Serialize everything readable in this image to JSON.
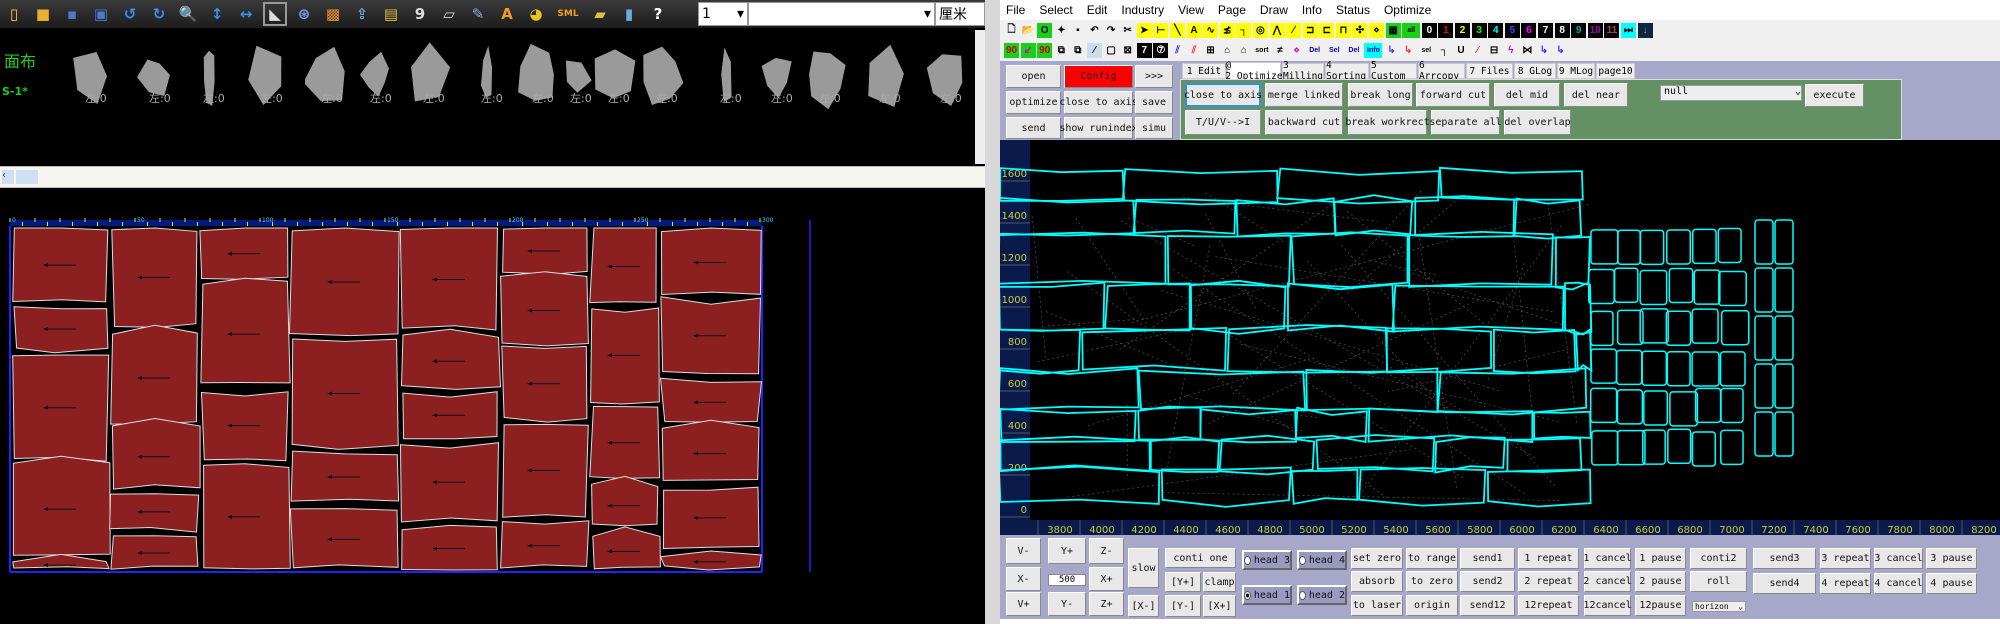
{
  "left_app": {
    "toolbar": [
      {
        "icon": "new-file-icon",
        "glyph": "▯",
        "color": "#f5c842"
      },
      {
        "icon": "open-folder-icon",
        "glyph": "■",
        "color": "#e8b030"
      },
      {
        "icon": "save-icon",
        "glyph": "▪",
        "color": "#4a7bd0"
      },
      {
        "icon": "save-as-icon",
        "glyph": "▣",
        "color": "#4a7bd0"
      },
      {
        "icon": "undo-icon",
        "glyph": "↺",
        "color": "#3a8ef0"
      },
      {
        "icon": "redo-icon",
        "glyph": "↻",
        "color": "#3a8ef0"
      },
      {
        "icon": "zoom-icon",
        "glyph": "🔍",
        "color": "#ddd"
      },
      {
        "icon": "vertical-arrows-icon",
        "glyph": "↕",
        "color": "#3a8ef0"
      },
      {
        "icon": "horizontal-arrows-icon",
        "glyph": "↔",
        "color": "#3a8ef0"
      },
      {
        "icon": "select-piece-icon",
        "glyph": "◣",
        "color": "#ddd"
      },
      {
        "icon": "film-reel-icon",
        "glyph": "⊛",
        "color": "#7aa0e0"
      },
      {
        "icon": "grid-orange-icon",
        "glyph": "▩",
        "color": "#e89030"
      },
      {
        "icon": "export-icon",
        "glyph": "⇪",
        "color": "#6aaee0"
      },
      {
        "icon": "film-icon",
        "glyph": "▤",
        "color": "#e0c040"
      },
      {
        "icon": "nine-icon",
        "glyph": "9",
        "color": "#ddd"
      },
      {
        "icon": "notepad-icon",
        "glyph": "▱",
        "color": "#ddd"
      },
      {
        "icon": "tools-icon",
        "glyph": "✎",
        "color": "#8ab0e0"
      },
      {
        "icon": "text-a-icon",
        "glyph": "A",
        "color": "#f0a020"
      },
      {
        "icon": "color-wheel-icon",
        "glyph": "◕",
        "color": "#f0c020"
      },
      {
        "icon": "sml-icon",
        "glyph": "SML",
        "color": "#f0a020"
      },
      {
        "icon": "layers-icon",
        "glyph": "▰",
        "color": "#e0c040"
      },
      {
        "icon": "bottle-icon",
        "glyph": "▮",
        "color": "#6aaee0"
      },
      {
        "icon": "help-icon",
        "glyph": "?",
        "color": "#fff"
      }
    ],
    "layer_select": "1",
    "combo_value": "",
    "unit_select": "厘米",
    "strip_title": "面布",
    "strip_row_label": "S-1*",
    "piece_labels": [
      "左:0",
      "左:0",
      "左:0",
      "左:0",
      "左:0",
      "左:0",
      "左:0",
      "左:0",
      "左:0",
      "左:0",
      "左:0",
      "左:0",
      "左:0",
      "左:0",
      "左:0",
      "左:0",
      "左:0"
    ],
    "ruler_labels": [
      "0",
      "50",
      "100",
      "150",
      "200",
      "250",
      "300"
    ],
    "piece_color": "#8c2020"
  },
  "right_app": {
    "menu": [
      "File",
      "Select",
      "Edit",
      "Industry",
      "View",
      "Page",
      "Draw",
      "Info",
      "Status",
      "Optimize"
    ],
    "toolbar1": [
      {
        "icon": "new-icon",
        "t": "🗋",
        "bg": ""
      },
      {
        "icon": "open-icon",
        "t": "📂",
        "bg": ""
      },
      {
        "icon": "circle-icon",
        "t": "O",
        "bg": "#19d019"
      },
      {
        "icon": "open-star-icon",
        "t": "✦",
        "bg": ""
      },
      {
        "icon": "save-icon",
        "t": "▪",
        "bg": ""
      },
      {
        "icon": "undo-icon",
        "t": "↶",
        "bg": ""
      },
      {
        "icon": "redo-icon",
        "t": "↷",
        "bg": ""
      },
      {
        "icon": "cut-icon",
        "t": "✂",
        "bg": ""
      },
      {
        "icon": "pointer-icon",
        "t": "➤",
        "bg": "#ffff00"
      },
      {
        "icon": "dimension-icon",
        "t": "⊢",
        "bg": "#ffff00"
      },
      {
        "icon": "line-icon",
        "t": "╲",
        "bg": "#ffff00"
      },
      {
        "icon": "text-icon",
        "t": "A",
        "bg": "#ffff00"
      },
      {
        "icon": "wave-icon",
        "t": "∿",
        "bg": "#ffff00"
      },
      {
        "icon": "curve-icon",
        "t": "≴",
        "bg": "#ffff00"
      },
      {
        "icon": "corner-icon",
        "t": "┐",
        "bg": "#ffff00"
      },
      {
        "icon": "circle-point-icon",
        "t": "◎",
        "bg": "#ffff00"
      },
      {
        "icon": "angle-icon",
        "t": "⋀",
        "bg": "#ffff00"
      },
      {
        "icon": "slash-icon",
        "t": "⁄",
        "bg": "#ffff00"
      },
      {
        "icon": "node1-icon",
        "t": "⊐",
        "bg": "#ffff00"
      },
      {
        "icon": "node2-icon",
        "t": "⊏",
        "bg": "#ffff00"
      },
      {
        "icon": "node3-icon",
        "t": "⊓",
        "bg": "#ffff00"
      },
      {
        "icon": "move-icon",
        "t": "✣",
        "bg": "#ffff00"
      },
      {
        "icon": "node4-icon",
        "t": "⋄",
        "bg": "#ffff00"
      },
      {
        "icon": "group-icon",
        "t": "▦",
        "bg": "#19d019"
      },
      {
        "icon": "all-icon",
        "t": "all",
        "bg": "#19d019"
      },
      {
        "icon": "num-0-icon",
        "t": "0",
        "bg": "#000",
        "c": "#fff"
      },
      {
        "icon": "num-1-icon",
        "t": "1",
        "bg": "#000",
        "c": "#f00"
      },
      {
        "icon": "num-2-icon",
        "t": "2",
        "bg": "#000",
        "c": "#ff0"
      },
      {
        "icon": "num-3-icon",
        "t": "3",
        "bg": "#000",
        "c": "#0f0"
      },
      {
        "icon": "num-4-icon",
        "t": "4",
        "bg": "#000",
        "c": "#0ff"
      },
      {
        "icon": "num-5-icon",
        "t": "5",
        "bg": "#000",
        "c": "#44f"
      },
      {
        "icon": "num-6-icon",
        "t": "6",
        "bg": "#000",
        "c": "#f0f"
      },
      {
        "icon": "num-7-icon",
        "t": "7",
        "bg": "#000",
        "c": "#fff"
      },
      {
        "icon": "num-8-icon",
        "t": "8",
        "bg": "#000",
        "c": "#fff"
      },
      {
        "icon": "num-9-icon",
        "t": "9",
        "bg": "#000",
        "c": "#0aa"
      },
      {
        "icon": "num-10-icon",
        "t": "10",
        "bg": "#000",
        "c": "#a0a"
      },
      {
        "icon": "num-11-icon",
        "t": "11",
        "bg": "#000",
        "c": "#a44"
      },
      {
        "icon": "skip-icon",
        "t": "⏭",
        "bg": "#0ff"
      },
      {
        "icon": "down-arrow-icon",
        "t": "↓",
        "bg": "#124",
        "c": "#0f0"
      }
    ],
    "toolbar2": [
      {
        "icon": "rotate-ccw90-icon",
        "t": "90",
        "bg": "#19d019",
        "c": "#c00"
      },
      {
        "icon": "corner-arrow-icon",
        "t": "↙",
        "bg": "#19d019",
        "c": "#c0c"
      },
      {
        "icon": "rotate-cw90-icon",
        "t": "90",
        "bg": "#19d019",
        "c": "#c00"
      },
      {
        "icon": "copy-icon",
        "t": "⧉",
        "bg": ""
      },
      {
        "icon": "delete-copy-icon",
        "t": "⧉",
        "bg": ""
      },
      {
        "icon": "cross-mark-icon",
        "t": "⁄",
        "bg": "#cde"
      },
      {
        "icon": "rounded-rect-icon",
        "t": "▢",
        "bg": ""
      },
      {
        "icon": "delete-group-icon",
        "t": "⊠",
        "bg": ""
      },
      {
        "icon": "seven-box-icon",
        "t": "7",
        "bg": "#000",
        "c": "#fff"
      },
      {
        "icon": "seven-circle-icon",
        "t": "⑦",
        "bg": "#000",
        "c": "#fff"
      },
      {
        "icon": "parallel-lines-icon",
        "t": "⫽",
        "bg": "",
        "c": "#33f"
      },
      {
        "icon": "parallel-lines2-icon",
        "t": "⫽",
        "bg": "",
        "c": "#f33"
      },
      {
        "icon": "split-squares-icon",
        "t": "⊞",
        "bg": ""
      },
      {
        "icon": "shape-icon",
        "t": "⌂",
        "bg": ""
      },
      {
        "icon": "shape2-icon",
        "t": "⌂",
        "bg": ""
      },
      {
        "icon": "sort-icon",
        "t": "sort",
        "bg": ""
      },
      {
        "icon": "path-icon",
        "t": "≠",
        "bg": ""
      },
      {
        "icon": "nodes-icon",
        "t": "⋄",
        "bg": "",
        "c": "#c0c"
      },
      {
        "icon": "del-same-icon",
        "t": "Del",
        "bg": "",
        "c": "#00a"
      },
      {
        "icon": "sel-same-icon",
        "t": "Sel",
        "bg": "",
        "c": "#00a"
      },
      {
        "icon": "del-icon",
        "t": "Del",
        "bg": "",
        "c": "#00a"
      },
      {
        "icon": "info-icon",
        "t": "Info",
        "bg": "#0ff",
        "c": "#00a"
      },
      {
        "icon": "path2-icon",
        "t": "↳",
        "bg": "",
        "c": "#33f"
      },
      {
        "icon": "path3-icon",
        "t": "↳",
        "bg": "",
        "c": "#f33"
      },
      {
        "icon": "sel-icon",
        "t": "sel",
        "bg": ""
      },
      {
        "icon": "hook-icon",
        "t": "┐",
        "bg": ""
      },
      {
        "icon": "u-icon",
        "t": "U",
        "bg": ""
      },
      {
        "icon": "edit-line-icon",
        "t": "⁄",
        "bg": "",
        "c": "#c33"
      },
      {
        "icon": "box-stack-icon",
        "t": "⊟",
        "bg": ""
      },
      {
        "icon": "zigzag-icon",
        "t": "ϟ",
        "bg": "",
        "c": "#c0c"
      },
      {
        "icon": "cross-wave-icon",
        "t": "⋈",
        "bg": ""
      },
      {
        "icon": "path4-icon",
        "t": "↳",
        "bg": "",
        "c": "#33f"
      },
      {
        "icon": "path5-icon",
        "t": "↳",
        "bg": "",
        "c": "#33f"
      }
    ],
    "side_buttons": {
      "open": "open",
      "config": "Config",
      "more": ">>>",
      "optimize": "optimize",
      "close_to_axis": "close to axis",
      "save": "save",
      "send": "send",
      "show_runindex": "show runindex",
      "simu": "simu"
    },
    "config_color": "#ff0000",
    "tabs": [
      "1 Edit",
      "@ 2_Optimize",
      "3 Milling",
      "4 Sorting",
      "5 Custom",
      "6 Arrcopy",
      "7 Files",
      "8 GLog",
      "9 MLog",
      "page10"
    ],
    "active_tab": 1,
    "optimize_panel": {
      "row1": [
        "close to axis",
        "merge linked",
        "break long",
        "forward cut",
        "del mid",
        "del near"
      ],
      "row2": [
        "T/U/V-->I",
        "backward cut",
        "break workrect",
        "separate all",
        "del overlap"
      ],
      "select_value": "null",
      "execute": "execute",
      "panel_color": "#639163"
    },
    "canvas": {
      "x_ticks": [
        "3800",
        "4000",
        "4200",
        "4400",
        "4600",
        "4800",
        "5000",
        "5200",
        "5400",
        "5600",
        "5800",
        "6000",
        "6200",
        "6400",
        "6600",
        "6800",
        "7000",
        "7200",
        "7400",
        "7600",
        "7800",
        "8000",
        "8200"
      ],
      "y_ticks": [
        "0",
        "200",
        "400",
        "600",
        "800",
        "1000",
        "1200",
        "1400",
        "1600"
      ],
      "outline_color": "#00ffff"
    },
    "controls": {
      "jog": {
        "v_minus": "V-",
        "y_plus": "Y+",
        "z_minus": "Z-",
        "x_minus": "X-",
        "step": "500",
        "x_plus": "X+",
        "v_plus": "V+",
        "y_minus": "Y-",
        "z_plus": "Z+",
        "slow": "slow"
      },
      "conti_one": "conti one",
      "bracket_y_plus": "[Y+]",
      "clamp": "clamp",
      "bracket_x_minus": "[X-]",
      "bracket_y_minus": "[Y-]",
      "bracket_x_plus": "[X+]",
      "heads": [
        {
          "label": "head 3",
          "checked": false
        },
        {
          "label": "head 4",
          "checked": false
        },
        {
          "label": "head 1",
          "checked": true
        },
        {
          "label": "head 2",
          "checked": false
        }
      ],
      "col1": [
        "set zero",
        "absorb",
        "to laser"
      ],
      "col2": [
        "to range",
        "to zero",
        "origin"
      ],
      "col3": [
        "send1",
        "send2",
        "send12"
      ],
      "col4": [
        "1 repeat",
        "2 repeat",
        "12repeat"
      ],
      "col5": [
        "1 cancel",
        "2 cancel",
        "12cancel"
      ],
      "col6": [
        "1 pause",
        "2 pause",
        "12pause"
      ],
      "col7": [
        "conti2",
        "roll"
      ],
      "direction_select": "horizon",
      "col8": [
        "send3",
        "send4"
      ],
      "col9": [
        "3 repeat",
        "4 repeat"
      ],
      "col10": [
        "3 cancel",
        "4 cancel"
      ],
      "col11": [
        "3 pause",
        "4 pause"
      ]
    }
  }
}
